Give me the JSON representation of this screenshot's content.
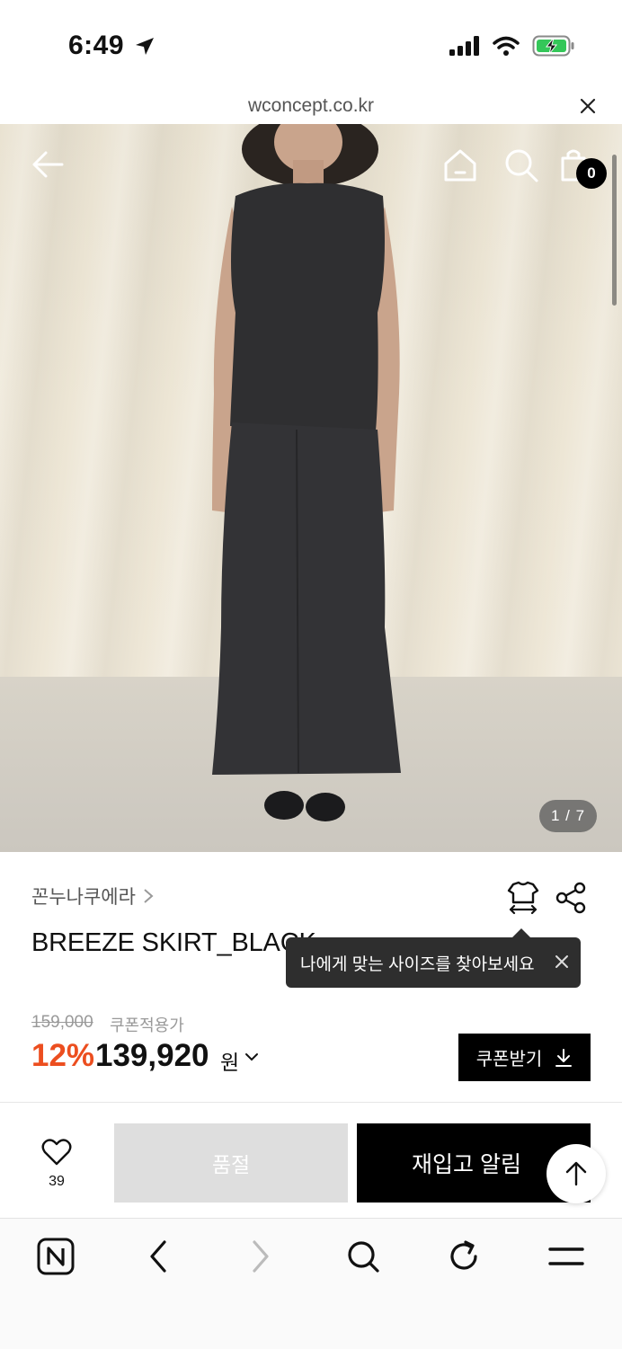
{
  "status_bar": {
    "time": "6:49",
    "icons": [
      "location-arrow-icon",
      "cellular-signal-icon",
      "wifi-icon",
      "battery-charging-icon"
    ]
  },
  "browser": {
    "url": "wconcept.co.kr"
  },
  "gallery": {
    "counter": "1 / 7",
    "cart_count": "0"
  },
  "product": {
    "brand": "꼰누나쿠에라",
    "title": "BREEZE SKIRT_BLACK",
    "original_price": "159,000",
    "coupon_label": "쿠폰적용가",
    "discount": "12%",
    "price": "139,920",
    "currency": "원",
    "coupon_button": "쿠폰받기"
  },
  "tooltip": {
    "text": "나에게 맞는 사이즈를 찾아보세요"
  },
  "actions": {
    "like_count": "39",
    "soldout_label": "품절",
    "restock_label": "재입고 알림"
  },
  "colors": {
    "accent_discount": "#ec4e1f",
    "primary_button": "#000000",
    "disabled_button": "#dedede"
  }
}
